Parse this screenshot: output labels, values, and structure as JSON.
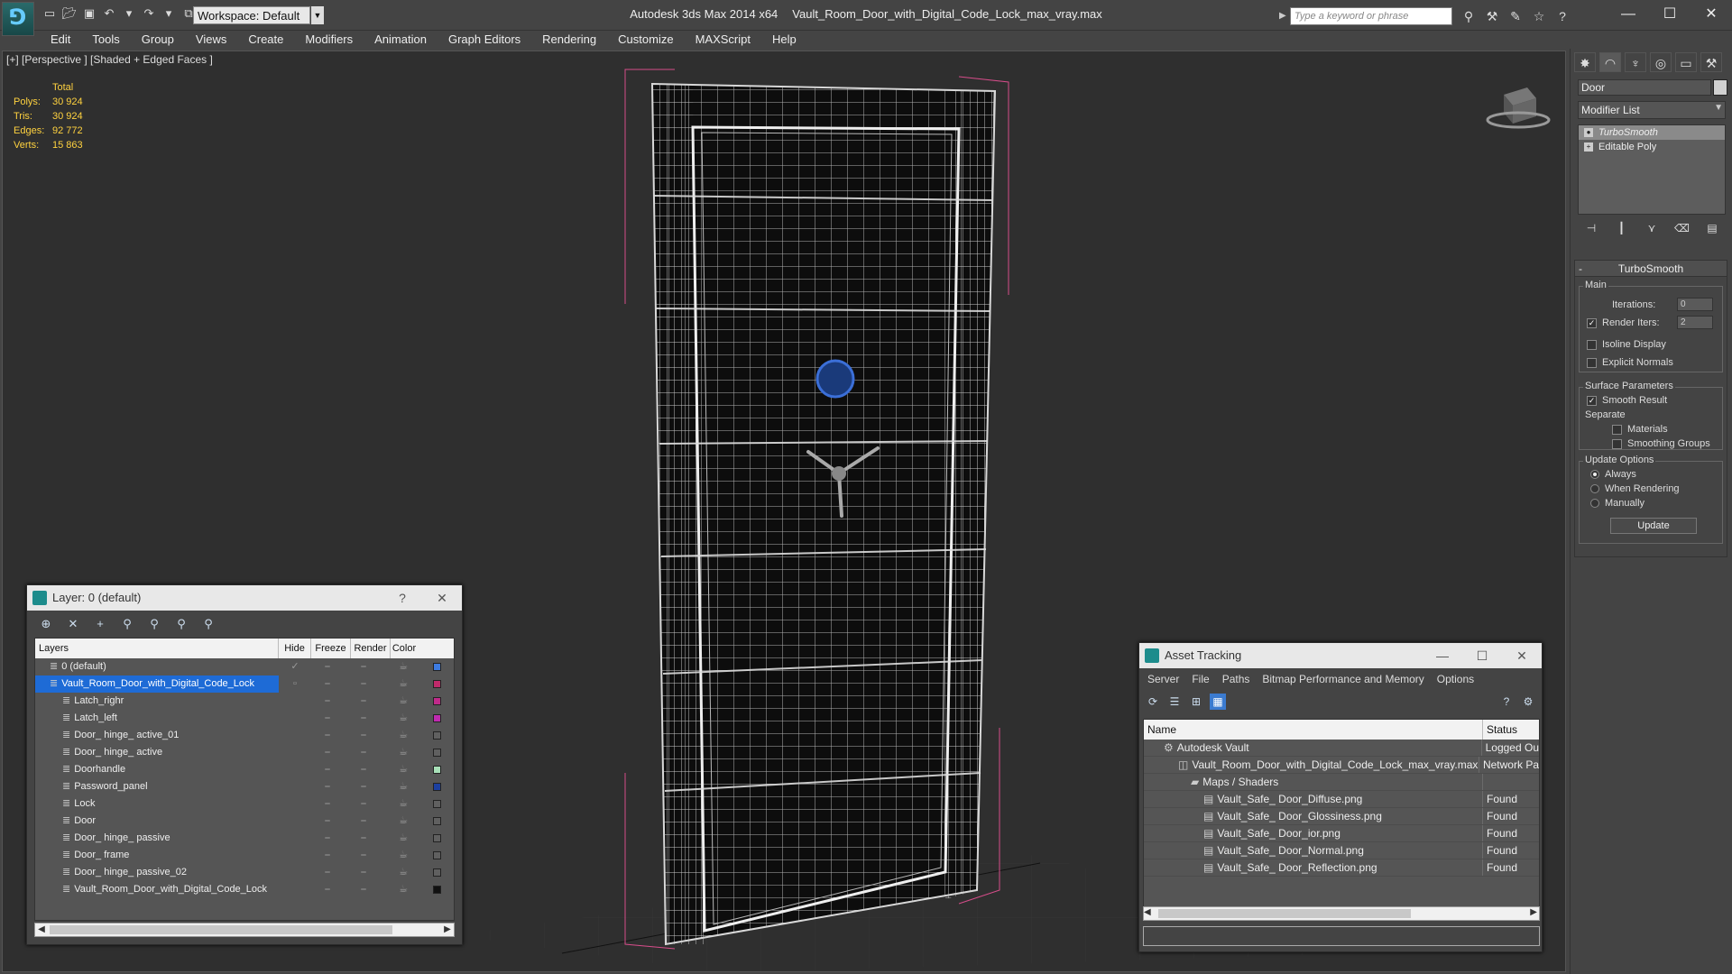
{
  "app": {
    "title": "Autodesk 3ds Max  2014 x64",
    "file": "Vault_Room_Door_with_Digital_Code_Lock_max_vray.max",
    "workspace": "Workspace: Default",
    "search_placeholder": "Type a keyword or phrase"
  },
  "menu": [
    "Edit",
    "Tools",
    "Group",
    "Views",
    "Create",
    "Modifiers",
    "Animation",
    "Graph Editors",
    "Rendering",
    "Customize",
    "MAXScript",
    "Help"
  ],
  "viewport": {
    "label": "[+] [Perspective ] [Shaded + Edged Faces ]",
    "stats": {
      "header": "Total",
      "rows": [
        {
          "k": "Polys:",
          "v": "30 924"
        },
        {
          "k": "Tris:",
          "v": "30 924"
        },
        {
          "k": "Edges:",
          "v": "92 772"
        },
        {
          "k": "Verts:",
          "v": "15 863"
        }
      ]
    }
  },
  "layer_panel": {
    "title": "Layer: 0 (default)",
    "help": "?",
    "close": "✕",
    "cols": [
      "Layers",
      "Hide",
      "Freeze",
      "Render",
      "Color"
    ],
    "rows": [
      {
        "name": "0 (default)",
        "indent": 1,
        "color": "#3d7be0",
        "check": true
      },
      {
        "name": "Vault_Room_Door_with_Digital_Code_Lock",
        "indent": 1,
        "color": "#c02a6a",
        "sel": true
      },
      {
        "name": "Latch_righr",
        "indent": 2,
        "color": "#c02a8a"
      },
      {
        "name": "Latch_left",
        "indent": 2,
        "color": "#c02ab0"
      },
      {
        "name": "Door_ hinge_ active_01",
        "indent": 2,
        "color": "#606060"
      },
      {
        "name": "Door_ hinge_ active",
        "indent": 2,
        "color": "#606060"
      },
      {
        "name": "Doorhandle",
        "indent": 2,
        "color": "#a8e0b8"
      },
      {
        "name": "Password_panel",
        "indent": 2,
        "color": "#1b3fa0"
      },
      {
        "name": "Lock",
        "indent": 2,
        "color": "#606060"
      },
      {
        "name": "Door",
        "indent": 2,
        "color": "#606060"
      },
      {
        "name": "Door_ hinge_ passive",
        "indent": 2,
        "color": "#606060"
      },
      {
        "name": "Door_ frame",
        "indent": 2,
        "color": "#606060"
      },
      {
        "name": "Door_ hinge_ passive_02",
        "indent": 2,
        "color": "#606060"
      },
      {
        "name": "Vault_Room_Door_with_Digital_Code_Lock",
        "indent": 2,
        "color": "#111111"
      }
    ]
  },
  "asset_panel": {
    "title": "Asset Tracking",
    "menu": [
      "Server",
      "File",
      "Paths",
      "Bitmap Performance and Memory",
      "Options"
    ],
    "cols": [
      "Name",
      "Status"
    ],
    "rows": [
      {
        "name": "Autodesk Vault",
        "status": "Logged Ou",
        "indent": 0
      },
      {
        "name": "Vault_Room_Door_with_Digital_Code_Lock_max_vray.max",
        "status": "Network Pa",
        "indent": 1
      },
      {
        "name": "Maps / Shaders",
        "status": "",
        "indent": 2
      },
      {
        "name": "Vault_Safe_ Door_Diffuse.png",
        "status": "Found",
        "indent": 3
      },
      {
        "name": "Vault_Safe_ Door_Glossiness.png",
        "status": "Found",
        "indent": 3
      },
      {
        "name": "Vault_Safe_ Door_ior.png",
        "status": "Found",
        "indent": 3
      },
      {
        "name": "Vault_Safe_ Door_Normal.png",
        "status": "Found",
        "indent": 3
      },
      {
        "name": "Vault_Safe_ Door_Reflection.png",
        "status": "Found",
        "indent": 3
      }
    ]
  },
  "command_panel": {
    "object_name": "Door",
    "modifier_list": "Modifier List",
    "stack": [
      "TurboSmooth",
      "Editable Poly"
    ],
    "rollout": "TurboSmooth",
    "main": "Main",
    "iterations_label": "Iterations:",
    "iterations": "0",
    "render_iters_label": "Render Iters:",
    "render_iters": "2",
    "isoline": "Isoline Display",
    "explicit": "Explicit Normals",
    "surface": "Surface Parameters",
    "smooth_result": "Smooth Result",
    "separate": "Separate",
    "materials": "Materials",
    "smoothing_groups": "Smoothing Groups",
    "update_options": "Update Options",
    "always": "Always",
    "when_rendering": "When Rendering",
    "manually": "Manually",
    "update": "Update"
  }
}
